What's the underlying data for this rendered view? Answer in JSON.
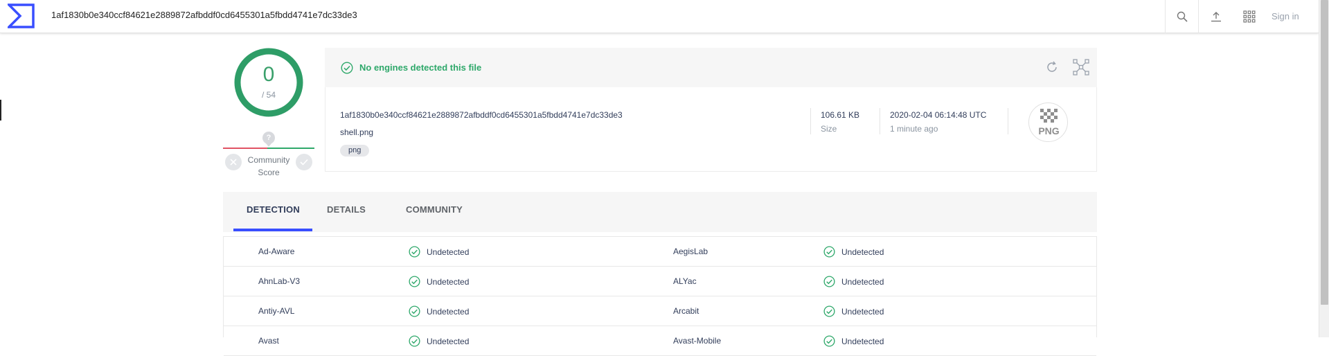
{
  "topbar": {
    "search_value": "1af1830b0e340ccf84621e2889872afbddf0cd6455301a5fbdd4741e7dc33de3",
    "signin_label": "Sign in"
  },
  "score": {
    "detections": "0",
    "total": "/ 54"
  },
  "community": {
    "label_line1": "Community",
    "label_line2": "Score",
    "question_mark": "?"
  },
  "summary": {
    "status_text": "No engines detected this file",
    "status_color": "#2ea86a"
  },
  "file": {
    "hash": "1af1830b0e340ccf84621e2889872afbddf0cd6455301a5fbdd4741e7dc33de3",
    "name": "shell.png",
    "tag": "png",
    "size": "106.61 KB",
    "size_label": "Size",
    "date": "2020-02-04 06:14:48 UTC",
    "date_relative": "1 minute ago",
    "type_badge": "PNG"
  },
  "tabs": [
    {
      "label": "DETECTION",
      "active": true
    },
    {
      "label": "DETAILS",
      "active": false
    },
    {
      "label": "COMMUNITY",
      "active": false
    }
  ],
  "detections": [
    {
      "left_engine": "Ad-Aware",
      "left_result": "Undetected",
      "right_engine": "AegisLab",
      "right_result": "Undetected"
    },
    {
      "left_engine": "AhnLab-V3",
      "left_result": "Undetected",
      "right_engine": "ALYac",
      "right_result": "Undetected"
    },
    {
      "left_engine": "Antiy-AVL",
      "left_result": "Undetected",
      "right_engine": "Arcabit",
      "right_result": "Undetected"
    },
    {
      "left_engine": "Avast",
      "left_result": "Undetected",
      "right_engine": "Avast-Mobile",
      "right_result": "Undetected"
    }
  ],
  "colors": {
    "accent": "#394eff",
    "clean": "#2ea86a",
    "malicious": "#e05263"
  }
}
